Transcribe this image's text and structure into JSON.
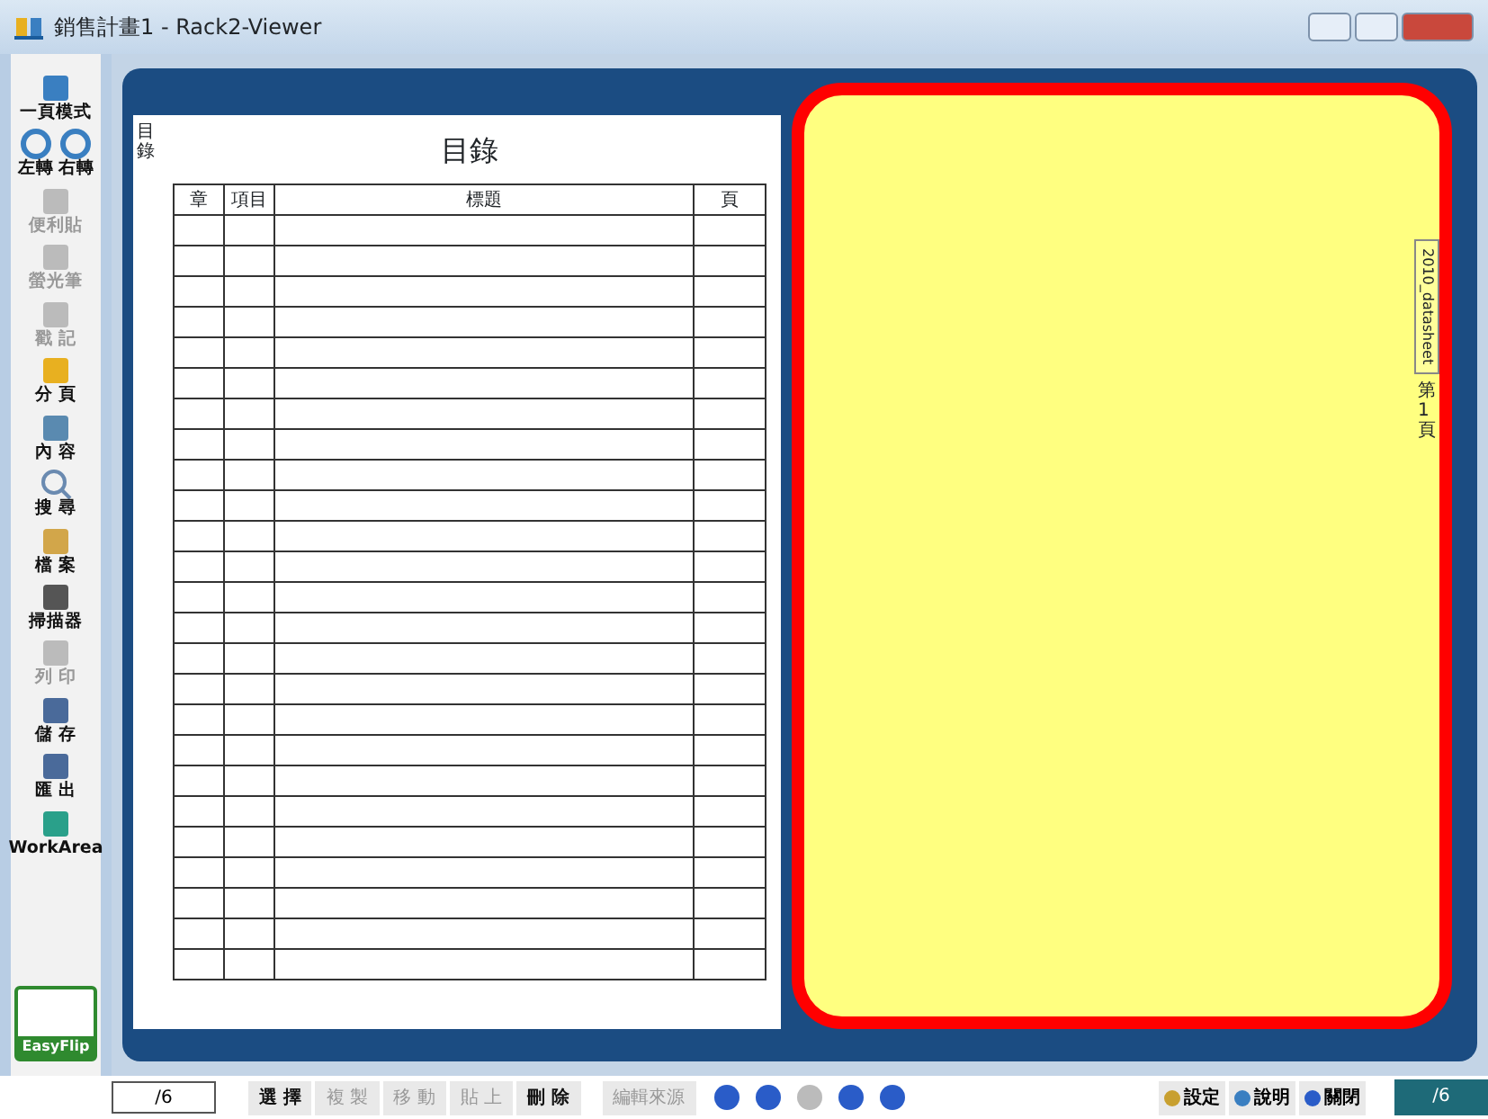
{
  "window": {
    "title": "銷售計畫1 - Rack2-Viewer"
  },
  "toolbar": [
    {
      "label": "一頁模式",
      "disabled": false
    },
    {
      "kind": "pair",
      "items": [
        {
          "label": "左轉",
          "disabled": false
        },
        {
          "label": "右轉",
          "disabled": false
        }
      ]
    },
    {
      "label": "便利貼",
      "disabled": true
    },
    {
      "label": "螢光筆",
      "disabled": true
    },
    {
      "label": "戳 記",
      "disabled": true
    },
    {
      "label": "分 頁",
      "disabled": false
    },
    {
      "label": "內 容",
      "disabled": false
    },
    {
      "label": "搜 尋",
      "disabled": false
    },
    {
      "label": "檔 案",
      "disabled": false
    },
    {
      "label": "掃描器",
      "disabled": false
    },
    {
      "label": "列 印",
      "disabled": true
    },
    {
      "label": "儲 存",
      "disabled": false
    },
    {
      "label": "匯 出",
      "disabled": false
    },
    {
      "label": "WorkArea",
      "disabled": false
    }
  ],
  "logo": {
    "label": "EasyFlip"
  },
  "book": {
    "left_page": {
      "side_tab": "目錄",
      "title": "目錄",
      "columns": [
        "章",
        "項目",
        "標題",
        "頁"
      ]
    },
    "right_page": {
      "tabs": [
        {
          "label": "2010_datasheet"
        },
        {
          "label": "第1頁"
        }
      ]
    }
  },
  "bottom_bar": {
    "page_field": "/6",
    "buttons": [
      {
        "label": "選 擇",
        "disabled": false
      },
      {
        "label": "複 製",
        "disabled": true
      },
      {
        "label": "移 動",
        "disabled": true
      },
      {
        "label": "貼 上",
        "disabled": true
      },
      {
        "label": "刪 除",
        "disabled": false
      },
      {
        "label": "編輯來源",
        "disabled": true
      }
    ],
    "links": [
      {
        "label": "設定"
      },
      {
        "label": "說明"
      },
      {
        "label": "關閉"
      }
    ],
    "page_indicator": "/6"
  }
}
